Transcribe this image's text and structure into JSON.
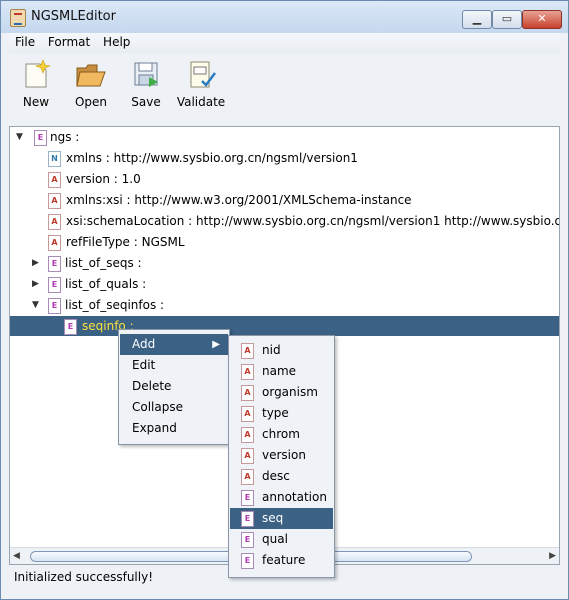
{
  "window": {
    "title": "NGSMLEditor"
  },
  "menu": [
    "File",
    "Format",
    "Help"
  ],
  "toolbar": [
    {
      "label": "New",
      "icon": "new-file-icon"
    },
    {
      "label": "Open",
      "icon": "open-folder-icon"
    },
    {
      "label": "Save",
      "icon": "save-disk-icon"
    },
    {
      "label": "Validate",
      "icon": "validate-icon"
    }
  ],
  "tree": {
    "nodes": [
      {
        "text": "ngs :",
        "icon": "E",
        "expander": "▼"
      },
      {
        "text": "xmlns : http://www.sysbio.org.cn/ngsml/version1",
        "icon": "N"
      },
      {
        "text": "version : 1.0",
        "icon": "A"
      },
      {
        "text": "xmlns:xsi : http://www.w3.org/2001/XMLSchema-instance",
        "icon": "A"
      },
      {
        "text": "xsi:schemaLocation : http://www.sysbio.org.cn/ngsml/version1 http://www.sysbio.org.cn/ngsml",
        "icon": "A"
      },
      {
        "text": "refFileType : NGSML",
        "icon": "A"
      },
      {
        "text": "list_of_seqs :",
        "icon": "E",
        "expander": "▶"
      },
      {
        "text": "list_of_quals :",
        "icon": "E",
        "expander": "▶"
      },
      {
        "text": "list_of_seqinfos :",
        "icon": "E",
        "expander": "▼"
      },
      {
        "text": "seqinfo :",
        "icon": "E"
      }
    ]
  },
  "context_menu": {
    "items": [
      "Add",
      "Edit",
      "Delete",
      "Collapse",
      "Expand"
    ],
    "highlighted": "Add",
    "submenu_arrow": "▶"
  },
  "submenu": {
    "items": [
      {
        "text": "nid",
        "icon": "A"
      },
      {
        "text": "name",
        "icon": "A"
      },
      {
        "text": "organism",
        "icon": "A"
      },
      {
        "text": "type",
        "icon": "A"
      },
      {
        "text": "chrom",
        "icon": "A"
      },
      {
        "text": "version",
        "icon": "A"
      },
      {
        "text": "desc",
        "icon": "A"
      },
      {
        "text": "annotation",
        "icon": "E"
      },
      {
        "text": "seq",
        "icon": "E"
      },
      {
        "text": "qual",
        "icon": "E"
      },
      {
        "text": "feature",
        "icon": "E"
      }
    ],
    "highlighted": "seq"
  },
  "status": {
    "text": "Initialized successfully!"
  },
  "colors": {
    "selection": "#3b6185",
    "selected_text": "#fbe13b"
  }
}
